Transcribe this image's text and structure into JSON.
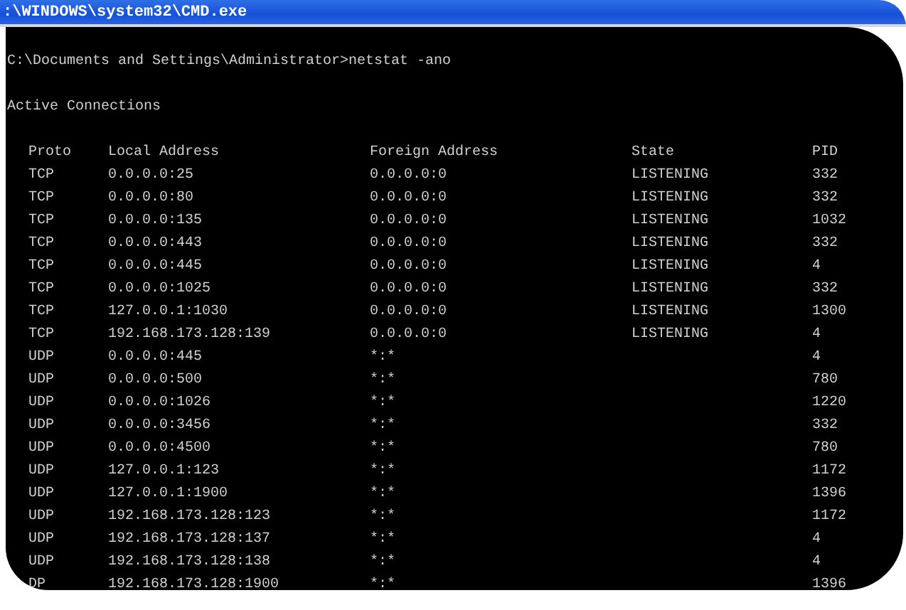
{
  "window": {
    "title": ":\\WINDOWS\\system32\\CMD.exe"
  },
  "console": {
    "command_line": "C:\\Documents and Settings\\Administrator>netstat -ano",
    "heading": "Active Connections",
    "table": {
      "columns": [
        "Proto",
        "Local Address",
        "Foreign Address",
        "State",
        "PID"
      ],
      "rows": [
        [
          "TCP",
          "0.0.0.0:25",
          "0.0.0.0:0",
          "LISTENING",
          "332"
        ],
        [
          "TCP",
          "0.0.0.0:80",
          "0.0.0.0:0",
          "LISTENING",
          "332"
        ],
        [
          "TCP",
          "0.0.0.0:135",
          "0.0.0.0:0",
          "LISTENING",
          "1032"
        ],
        [
          "TCP",
          "0.0.0.0:443",
          "0.0.0.0:0",
          "LISTENING",
          "332"
        ],
        [
          "TCP",
          "0.0.0.0:445",
          "0.0.0.0:0",
          "LISTENING",
          "4"
        ],
        [
          "TCP",
          "0.0.0.0:1025",
          "0.0.0.0:0",
          "LISTENING",
          "332"
        ],
        [
          "TCP",
          "127.0.0.1:1030",
          "0.0.0.0:0",
          "LISTENING",
          "1300"
        ],
        [
          "TCP",
          "192.168.173.128:139",
          "0.0.0.0:0",
          "LISTENING",
          "4"
        ],
        [
          "UDP",
          "0.0.0.0:445",
          "*:*",
          "",
          "4"
        ],
        [
          "UDP",
          "0.0.0.0:500",
          "*:*",
          "",
          "780"
        ],
        [
          "UDP",
          "0.0.0.0:1026",
          "*:*",
          "",
          "1220"
        ],
        [
          "UDP",
          "0.0.0.0:3456",
          "*:*",
          "",
          "332"
        ],
        [
          "UDP",
          "0.0.0.0:4500",
          "*:*",
          "",
          "780"
        ],
        [
          "UDP",
          "127.0.0.1:123",
          "*:*",
          "",
          "1172"
        ],
        [
          "UDP",
          "127.0.0.1:1900",
          "*:*",
          "",
          "1396"
        ],
        [
          "UDP",
          "192.168.173.128:123",
          "*:*",
          "",
          "1172"
        ],
        [
          "UDP",
          "192.168.173.128:137",
          "*:*",
          "",
          "4"
        ],
        [
          "UDP",
          "192.168.173.128:138",
          "*:*",
          "",
          "4"
        ],
        [
          "DP",
          "192.168.173.128:1900",
          "*:*",
          "",
          "1396"
        ]
      ]
    }
  }
}
